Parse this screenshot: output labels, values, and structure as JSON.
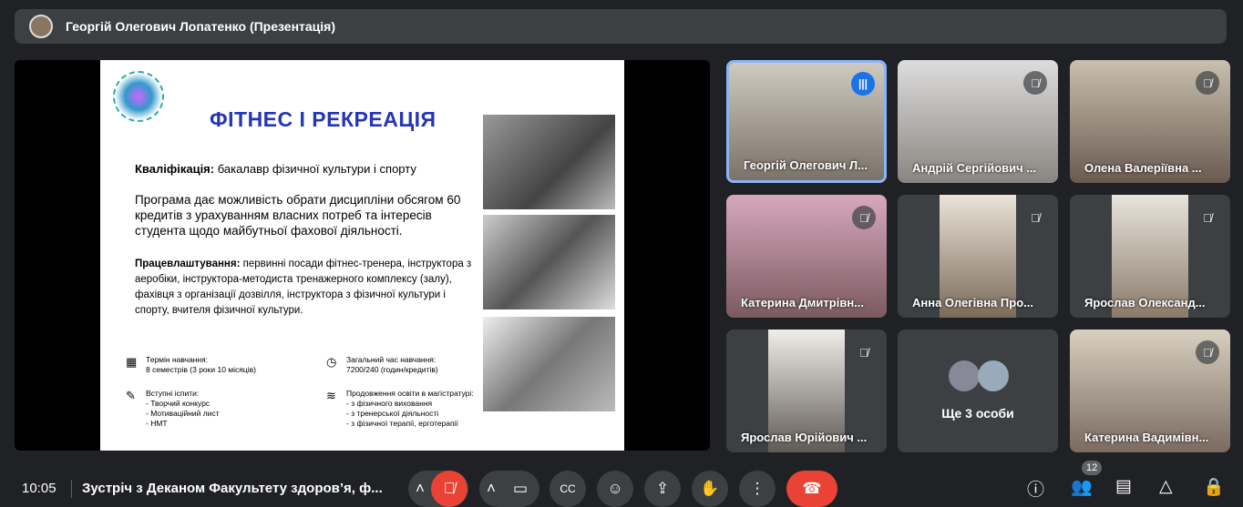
{
  "header": {
    "presenter": "Георгій Олегович Лопатенко (Презентація)"
  },
  "slide": {
    "title": "ФІТНЕС І РЕКРЕАЦІЯ",
    "qualification_label": "Кваліфікація:",
    "qualification": " бакалавр фізичної культури і спорту",
    "program": "Програма дає можливість обрати дисципліни обсягом 60 кредитів з урахуванням власних потреб та інтересів студента щодо майбутньої фахової діяльності.",
    "employment_label": "Працевлаштування:",
    "employment": " первинні посади фітнес-тренера, інструктора з аеробіки, інструктора-методиста тренажерного комплексу (залу), фахівця з організації дозвілля, інструктора з фізичної культури і спорту, вчителя фізичної культури.",
    "term_label": "Термін навчання:",
    "term": "8 семестрів (3 роки 10 місяців)",
    "hours_label": "Загальний час навчання:",
    "hours": "7200/240 (годин/кредитів)",
    "exams_label": "Вступні іспити:",
    "exams": [
      "-  Творчий конкурс",
      "-  Мотиваційний лист",
      "-  НМТ"
    ],
    "masters_label": "Продовження освіти в магістратурі:",
    "masters": [
      "-  з фізичного виховання",
      "-  з тренерської діяльності",
      "-  з фізичної терапії, ерготерапії"
    ]
  },
  "participants": [
    {
      "name": "Георгій Олегович Л...",
      "muted": false,
      "speaking": true
    },
    {
      "name": "Андрій Сергійович ...",
      "muted": true
    },
    {
      "name": "Олена Валеріївна ...",
      "muted": true
    },
    {
      "name": "Катерина Дмитрівн...",
      "muted": true
    },
    {
      "name": "Анна Олегівна Про...",
      "muted": true
    },
    {
      "name": "Ярослав Олександ...",
      "muted": true
    },
    {
      "name": "Ярослав Юрійович ...",
      "muted": true
    },
    {
      "name": "Ще 3 особи"
    },
    {
      "name": "Катерина Вадимівн...",
      "muted": true
    }
  ],
  "bottom": {
    "time": "10:05",
    "meeting_title": "Зустріч з Деканом Факультету здоров’я, ф...",
    "participant_count": "12"
  }
}
